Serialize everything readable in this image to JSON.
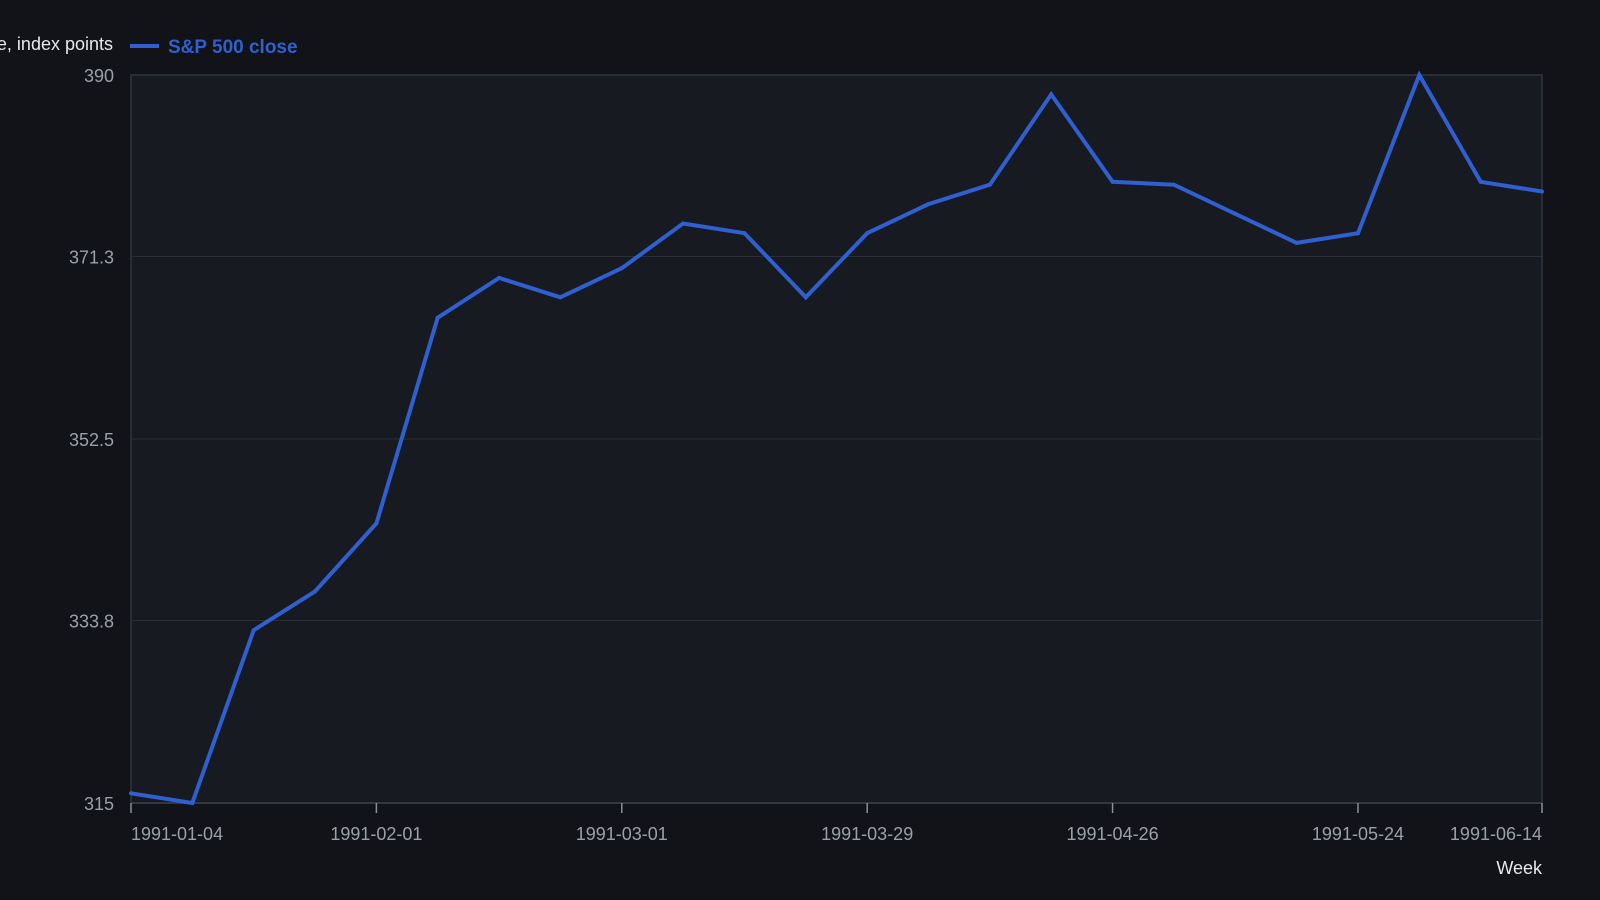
{
  "chart_data": {
    "type": "line",
    "ylabel": "Price, index points",
    "xlabel": "Week",
    "x": [
      "1991-01-04",
      "1991-01-11",
      "1991-01-18",
      "1991-01-25",
      "1991-02-01",
      "1991-02-08",
      "1991-02-15",
      "1991-02-22",
      "1991-03-01",
      "1991-03-08",
      "1991-03-15",
      "1991-03-22",
      "1991-03-29",
      "1991-04-05",
      "1991-04-12",
      "1991-04-19",
      "1991-04-26",
      "1991-05-03",
      "1991-05-10",
      "1991-05-17",
      "1991-05-24",
      "1991-05-31",
      "1991-06-07",
      "1991-06-14"
    ],
    "x_ticks": [
      "1991-01-04",
      "1991-02-01",
      "1991-03-01",
      "1991-03-29",
      "1991-04-26",
      "1991-05-24",
      "1991-06-14"
    ],
    "y_ticks": [
      "315",
      "333.8",
      "352.5",
      "371.3",
      "390"
    ],
    "ylim": [
      315,
      390
    ],
    "series": [
      {
        "name": "S&P 500 close",
        "color": "#2f5fd0",
        "values": [
          316.0,
          315.0,
          332.8,
          336.8,
          343.8,
          365.0,
          369.1,
          367.1,
          370.1,
          374.7,
          373.7,
          367.1,
          373.7,
          376.7,
          378.7,
          388.0,
          379.0,
          378.7,
          375.7,
          372.7,
          373.7,
          390.0,
          379.0,
          378.0
        ]
      }
    ],
    "legend_position": "top-left",
    "grid": true
  }
}
